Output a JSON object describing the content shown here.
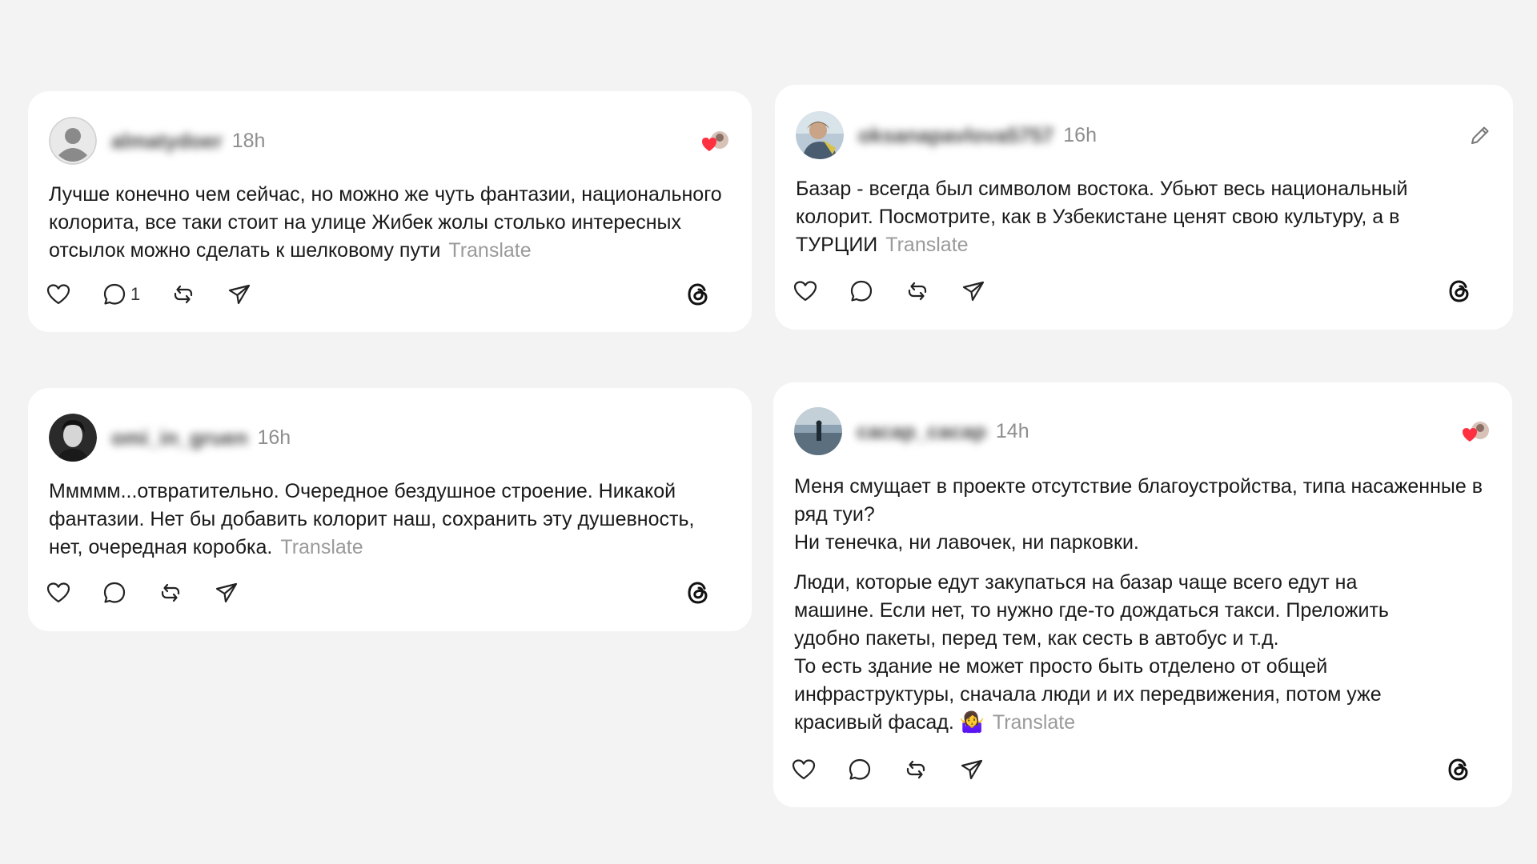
{
  "posts": [
    {
      "username": "almatydoer",
      "time": "18h",
      "paragraphs": [
        "Лучше конечно чем сейчас, но можно же чуть фантазии, национального колорита, все таки стоит на улице Жибек жолы столько интересных отсылок можно сделать к шелковому пути"
      ],
      "translate": "Translate",
      "reply_count": "1",
      "avatar": "default-avatar",
      "top_right": "liked-by-author-icon"
    },
    {
      "username": "oksanapavlova5757",
      "time": "16h",
      "paragraphs": [
        "Базар - всегда был символом востока. Убьют весь национальный колорит. Посмотрите, как в Узбекистане ценят свою культуру, а в ТУРЦИИ"
      ],
      "translate": "Translate",
      "reply_count": "",
      "avatar": "photo-avatar",
      "top_right": "edit-icon"
    },
    {
      "username": "omi_in_gruen",
      "time": "16h",
      "paragraphs": [
        "Ммммм...отвратительно. Очередное бездушное строение. Никакой фантазии. Нет бы добавить колорит наш, сохранить эту душевность, нет, очередная коробка."
      ],
      "translate": "Translate",
      "reply_count": "",
      "avatar": "photo-avatar"
    },
    {
      "username": "cacap_cacap",
      "time": "14h",
      "paragraphs": [
        "Меня смущает в проекте отсутствие благоустройства, типа насаженные в ряд туи?",
        "Ни тенечка, ни лавочек, ни парковки.",
        "",
        "Люди, которые едут закупаться на базар чаще всего едут на машине. Если нет, то нужно где-то дождаться такси. Преложить удобно пакеты, перед тем, как сесть в автобус и т.д.",
        "То есть здание не может просто быть отделено от общей инфраструктуры, сначала люди и их передвижения, потом уже красивый фасад. 🤷‍♀️"
      ],
      "translate": "Translate",
      "reply_count": "",
      "avatar": "photo-avatar",
      "top_right": "liked-by-author-icon"
    }
  ],
  "colors": {
    "background": "#f3f3f3",
    "card": "#ffffff",
    "muted": "#9a9a9a",
    "heart": "#ff3040"
  }
}
